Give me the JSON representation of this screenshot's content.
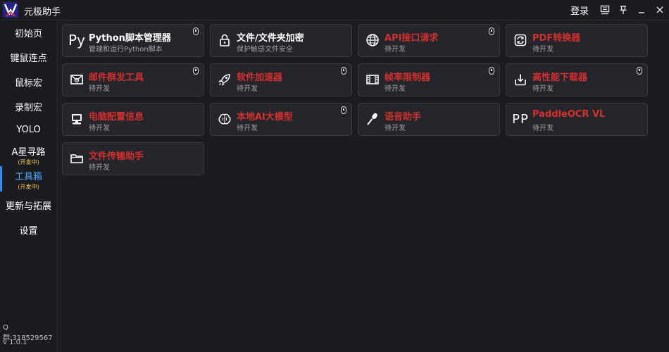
{
  "app": {
    "title": "元极助手",
    "login_label": "登录"
  },
  "colors": {
    "accent": "#2d8cf0",
    "wip_title": "#d32f2f",
    "ready_title": "#ffffff",
    "dev_tag": "#f2c94c",
    "panel": "#25262b"
  },
  "sidebar": {
    "items": [
      {
        "label": "初始页"
      },
      {
        "label": "键鼠连点"
      },
      {
        "label": "鼠标宏"
      },
      {
        "label": "录制宏"
      },
      {
        "label": "YOLO"
      },
      {
        "label": "A星寻路",
        "sub": "(开发中)"
      },
      {
        "label": "工具箱",
        "sub": "(开发中)",
        "active": true
      },
      {
        "label": "更新与拓展"
      },
      {
        "label": "设置"
      }
    ],
    "qq_group": "Q群:318529567",
    "version": "v 1.0.1"
  },
  "tools": [
    {
      "title": "Python脚本管理器",
      "subtitle": "管理和运行Python脚本",
      "icon": "python-icon",
      "status": "ready",
      "mouse_badge": true
    },
    {
      "title": "文件/文件夹加密",
      "subtitle": "保护敏感文件安全",
      "icon": "lock-icon",
      "status": "ready",
      "mouse_badge": false
    },
    {
      "title": "API接口请求",
      "subtitle": "待开发",
      "icon": "globe-icon",
      "status": "wip",
      "mouse_badge": true
    },
    {
      "title": "PDF转换器",
      "subtitle": "待开发",
      "icon": "convert-icon",
      "status": "wip",
      "mouse_badge": false
    },
    {
      "title": "邮件群发工具",
      "subtitle": "待开发",
      "icon": "mail-icon",
      "status": "wip",
      "mouse_badge": true
    },
    {
      "title": "软件加速器",
      "subtitle": "待开发",
      "icon": "rocket-icon",
      "status": "wip",
      "mouse_badge": true
    },
    {
      "title": "帧率限制器",
      "subtitle": "待开发",
      "icon": "film-icon",
      "status": "wip",
      "mouse_badge": true
    },
    {
      "title": "高性能下载器",
      "subtitle": "待开发",
      "icon": "download-icon",
      "status": "wip",
      "mouse_badge": true
    },
    {
      "title": "电脑配置信息",
      "subtitle": "待开发",
      "icon": "computer-icon",
      "status": "wip",
      "mouse_badge": false
    },
    {
      "title": "本地AI大模型",
      "subtitle": "待开发",
      "icon": "brain-icon",
      "status": "wip",
      "mouse_badge": true
    },
    {
      "title": "语音助手",
      "subtitle": "待开发",
      "icon": "microphone-icon",
      "status": "wip",
      "mouse_badge": false
    },
    {
      "title": "PaddleOCR VL",
      "subtitle": "待开发",
      "icon": "paddleocr-icon",
      "status": "wip",
      "mouse_badge": false
    },
    {
      "title": "文件传输助手",
      "subtitle": "待开发",
      "icon": "folder-icon",
      "status": "wip",
      "mouse_badge": false
    }
  ]
}
